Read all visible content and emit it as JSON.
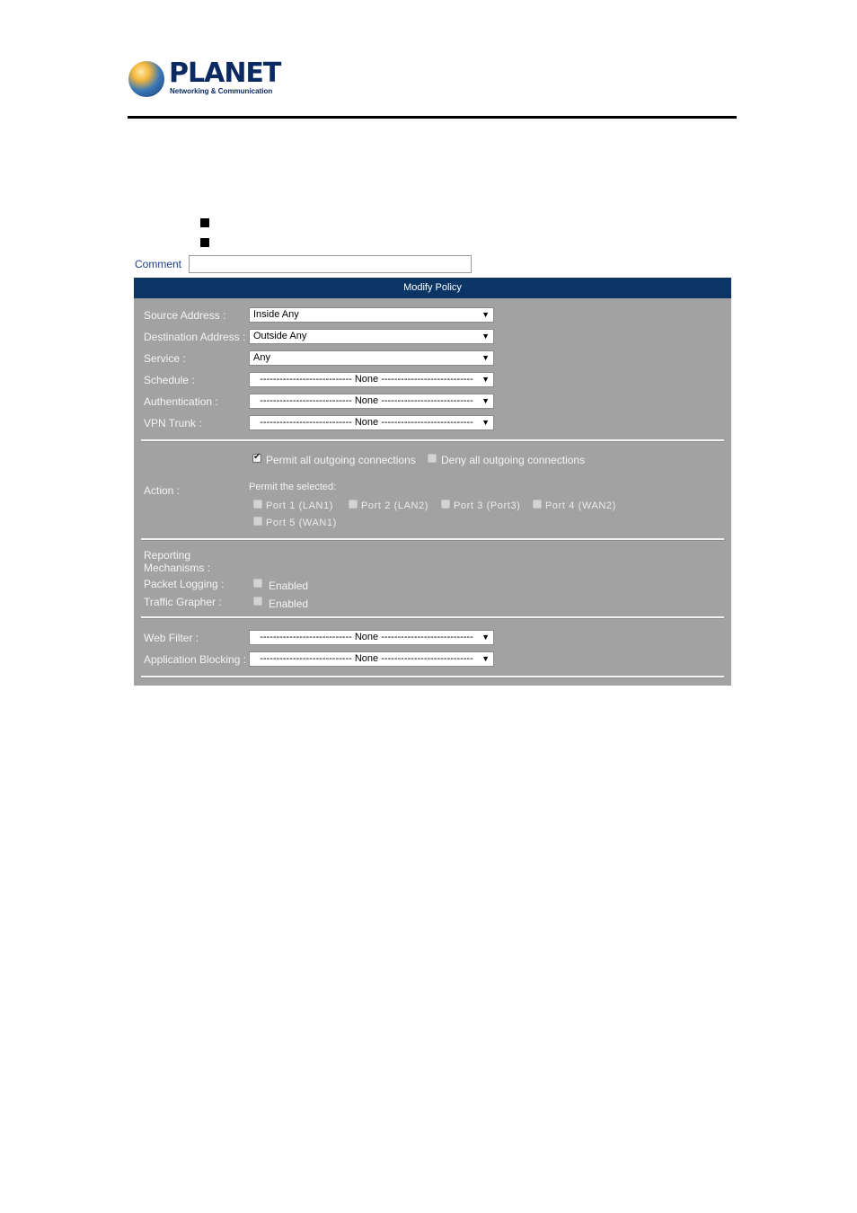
{
  "logo": {
    "brand": "PLANET",
    "tagline": "Networking & Communication"
  },
  "comment": {
    "label": "Comment",
    "value": ""
  },
  "panel": {
    "title": "Modify Policy",
    "fields": [
      {
        "label": "Source Address :",
        "value": "Inside Any",
        "dashed": false
      },
      {
        "label": "Destination Address :",
        "value": "Outside Any",
        "dashed": false
      },
      {
        "label": "Service :",
        "value": "Any",
        "dashed": false
      },
      {
        "label": "Schedule :",
        "value": "---------------------------- None ----------------------------",
        "dashed": true
      },
      {
        "label": "Authentication :",
        "value": "---------------------------- None ----------------------------",
        "dashed": true
      },
      {
        "label": "VPN Trunk :",
        "value": "---------------------------- None ----------------------------",
        "dashed": true
      }
    ],
    "action": {
      "label": "Action :",
      "permit_all": {
        "label": "Permit all outgoing connections",
        "checked": true
      },
      "deny_all": {
        "label": "Deny all outgoing connections",
        "checked": false
      },
      "permit_selected_label": "Permit the selected:",
      "ports": [
        {
          "label": "Port 1 (LAN1)",
          "checked": false
        },
        {
          "label": "Port 2 (LAN2)",
          "checked": false
        },
        {
          "label": "Port 3 (Port3)",
          "checked": false
        },
        {
          "label": "Port 4 (WAN2)",
          "checked": false
        },
        {
          "label": "Port 5 (WAN1)",
          "checked": false
        }
      ]
    },
    "reporting": {
      "label_line1": "Reporting",
      "label_line2": "Mechanisms :",
      "packet_logging": {
        "label": "Packet Logging :",
        "option": "Enabled",
        "checked": false
      },
      "traffic_grapher": {
        "label": "Traffic Grapher :",
        "option": "Enabled",
        "checked": false
      }
    },
    "filters": [
      {
        "label": "Web Filter :",
        "value": "---------------------------- None ----------------------------"
      },
      {
        "label": "Application Blocking :",
        "value": "---------------------------- None ----------------------------"
      }
    ]
  }
}
